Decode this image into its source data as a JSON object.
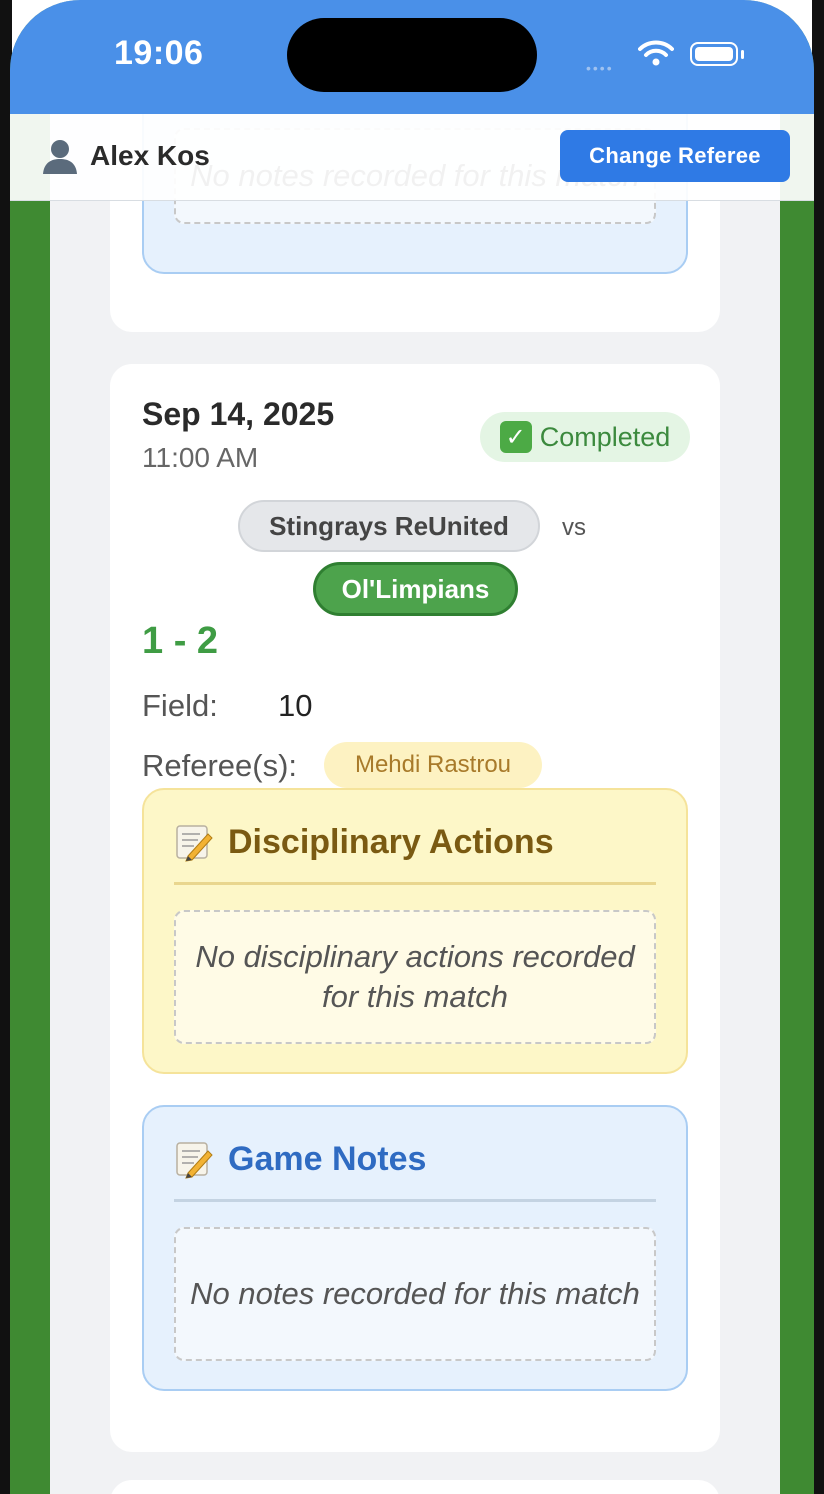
{
  "status_bar": {
    "time": "19:06"
  },
  "referee_bar": {
    "name": "Alex Kos",
    "change_button": "Change Referee"
  },
  "previous_match": {
    "notes": {
      "empty_text": "No notes recorded for this match"
    }
  },
  "match": {
    "date": "Sep 14, 2025",
    "time": "11:00 AM",
    "status": "Completed",
    "home_team": "Stingrays ReUnited",
    "vs": "vs",
    "away_team": "Ol'Limpians",
    "score": "1 - 2",
    "field_label": "Field:",
    "field_value": "10",
    "referee_label": "Referee(s):",
    "referee": "Mehdi Rastrou",
    "disciplinary": {
      "title": "Disciplinary Actions",
      "empty_text": "No disciplinary actions recorded for this match"
    },
    "notes": {
      "title": "Game Notes",
      "empty_text": "No notes recorded for this match"
    }
  },
  "colors": {
    "header_blue": "#4a90e8",
    "button_blue": "#2f7ae5",
    "field_green": "#3f8a32",
    "score_green": "#3f9c44",
    "winner_green": "#4da34c"
  },
  "icons": [
    "signal-icon",
    "wifi-icon",
    "battery-icon",
    "user-icon",
    "check-icon",
    "memo-icon"
  ]
}
